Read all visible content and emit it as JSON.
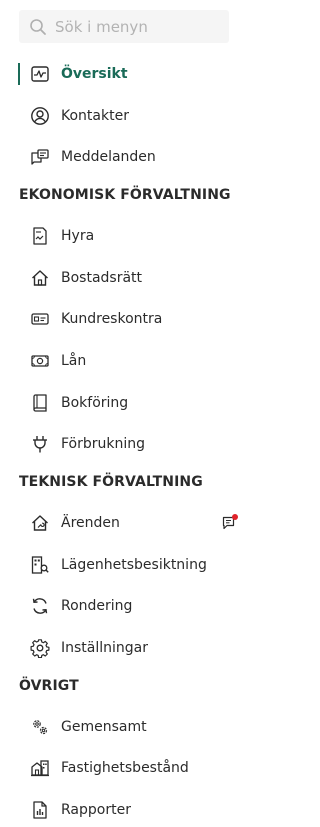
{
  "search": {
    "placeholder": "Sök i menyn",
    "icon": "search-icon"
  },
  "accent_color": "#1a6b58",
  "notification_color": "#e0222a",
  "top_items": [
    {
      "label": "Översikt",
      "icon": "activity-icon",
      "active": true
    },
    {
      "label": "Kontakter",
      "icon": "user-circle-icon"
    },
    {
      "label": "Meddelanden",
      "icon": "messages-icon"
    }
  ],
  "sections": [
    {
      "title": "EKONOMISK FÖRVALTNING",
      "items": [
        {
          "label": "Hyra",
          "icon": "invoice-icon"
        },
        {
          "label": "Bostadsrätt",
          "icon": "home-icon"
        },
        {
          "label": "Kundreskontra",
          "icon": "id-card-icon"
        },
        {
          "label": "Lån",
          "icon": "money-icon"
        },
        {
          "label": "Bokföring",
          "icon": "book-icon"
        },
        {
          "label": "Förbrukning",
          "icon": "plug-icon"
        }
      ]
    },
    {
      "title": "TEKNISK FÖRVALTNING",
      "items": [
        {
          "label": "Ärenden",
          "icon": "home-wrench-icon",
          "notification": true
        },
        {
          "label": "Lägenhetsbesiktning",
          "icon": "building-search-icon"
        },
        {
          "label": "Rondering",
          "icon": "refresh-icon"
        },
        {
          "label": "Inställningar",
          "icon": "gear-icon"
        }
      ]
    },
    {
      "title": "ÖVRIGT",
      "items": [
        {
          "label": "Gemensamt",
          "icon": "gears-icon"
        },
        {
          "label": "Fastighetsbestånd",
          "icon": "buildings-icon"
        },
        {
          "label": "Rapporter",
          "icon": "report-icon"
        }
      ]
    }
  ]
}
